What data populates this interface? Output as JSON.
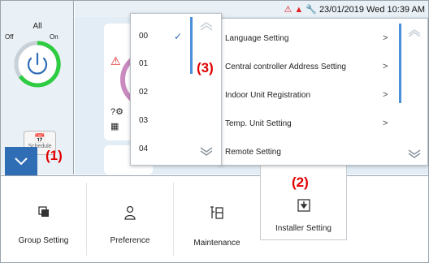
{
  "status_bar": {
    "datetime": "23/01/2019 Wed 10:39 AM",
    "icons": [
      "warning-icon",
      "filter-icon",
      "maintenance-icon"
    ]
  },
  "left_panel": {
    "all_label": "All",
    "off_label": "Off",
    "on_label": "On",
    "schedule_label": "Schedule",
    "power_state": "on"
  },
  "callouts": {
    "c1": "(1)",
    "c2": "(2)",
    "c3": "(3)"
  },
  "dropdown": {
    "items": [
      "00",
      "01",
      "02",
      "03",
      "04"
    ],
    "selected": "00"
  },
  "settings_menu": {
    "items": [
      "Language Setting",
      "Central controller Address Setting",
      "Indoor Unit Registration",
      "Temp. Unit Setting",
      "Remote Setting"
    ]
  },
  "bottom_menu": {
    "group_setting": "Group Setting",
    "preference": "Preference",
    "maintenance": "Maintenance",
    "installer_setting": "Installer Setting"
  },
  "colors": {
    "accent": "#2f6db5",
    "power_on": "#2ecc40",
    "warning": "#e02020",
    "callout": "#e00000"
  }
}
